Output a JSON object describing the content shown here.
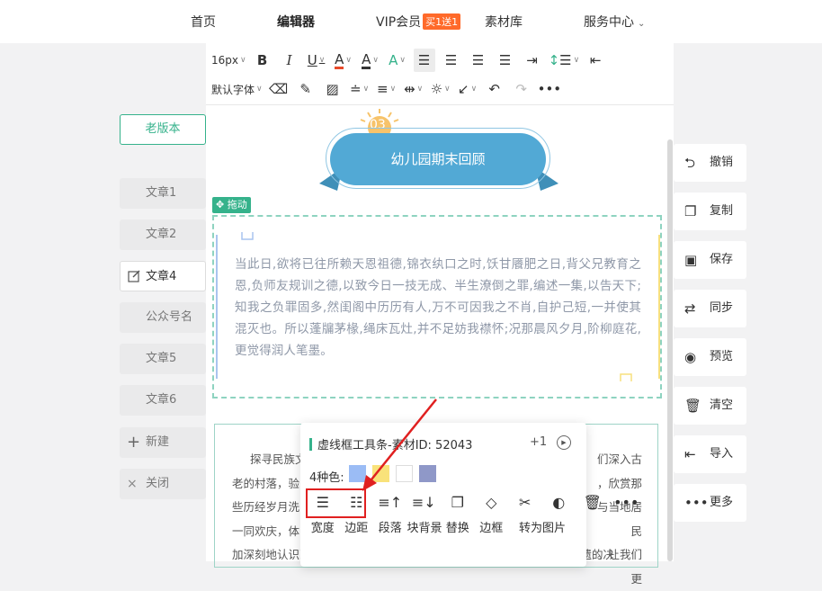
{
  "nav": {
    "home": "首页",
    "editor": "编辑器",
    "vip": "VIP会员",
    "vip_badge": "买1送1",
    "materials": "素材库",
    "service": "服务中心"
  },
  "toolbar": {
    "font_size": "16px",
    "font_family": "默认字体"
  },
  "sidebar": {
    "old_version": "老版本",
    "items": [
      {
        "label": "文章1"
      },
      {
        "label": "文章2"
      },
      {
        "label": "文章4"
      },
      {
        "label": "公众号名"
      },
      {
        "label": "文章5"
      },
      {
        "label": "文章6"
      },
      {
        "label": "新建"
      },
      {
        "label": "关闭"
      }
    ]
  },
  "editor": {
    "banner_number": "03",
    "banner_title": "幼儿园期末回顾",
    "drag_tag": "拖动",
    "frame_text": "当此日,欲将已往所赖天恩祖德,锦衣纨口之时,饫甘餍肥之日,背父兄教育之恩,负师友规训之德,以致今日一技无成、半生潦倒之罪,编述一集,以告天下;知我之负罪固多,然闺阁中历历有人,万不可因我之不肖,自护己短,一并使其混灭也。所以蓬牖茅椽,绳床瓦灶,并不足妨我襟怀;况那晨风夕月,阶柳庭花,更觉得润人笔墨。",
    "article2_lines": [
      "探寻民族文",
      "老的村落，验",
      "些历经岁月洗",
      "一同欢庆，体",
      "加深刻地认识到民族文化的博大精深，也更加坚定了我们传承和保护非遗的决"
    ],
    "article2_right": [
      "们深入古",
      "，欣赏那",
      "与当地居民",
      "。让我们更"
    ]
  },
  "popup": {
    "title": "虚线框工具条-素材ID: 52043",
    "plus": "+1",
    "colors_label": "4种色:",
    "colors": [
      "#9bbcf5",
      "#f9e27a",
      "#ffffff",
      "#8f98c8"
    ],
    "tools": [
      {
        "icon": "width-icon",
        "label": "宽度"
      },
      {
        "icon": "margin-icon",
        "label": "边距"
      },
      {
        "icon": "paragraph-up-icon",
        "label": "段落"
      },
      {
        "icon": "paragraph-down-icon",
        "label": "块背景"
      },
      {
        "icon": "copy-icon",
        "label": "替换"
      },
      {
        "icon": "eraser-icon",
        "label": "边框"
      },
      {
        "icon": "scissors-icon",
        "label": "转为图片"
      },
      {
        "icon": "contrast-icon",
        "label": ""
      },
      {
        "icon": "trash-icon",
        "label": ""
      },
      {
        "icon": "more-icon",
        "label": ""
      }
    ]
  },
  "actions": [
    {
      "icon": "undo-icon",
      "label": "撤销"
    },
    {
      "icon": "copy-icon",
      "label": "复制"
    },
    {
      "icon": "save-icon",
      "label": "保存"
    },
    {
      "icon": "sync-icon",
      "label": "同步"
    },
    {
      "icon": "eye-icon",
      "label": "预览"
    },
    {
      "icon": "trash-icon",
      "label": "清空"
    },
    {
      "icon": "import-icon",
      "label": "导入"
    },
    {
      "icon": "more-icon",
      "label": "更多"
    }
  ],
  "colors": {
    "accent": "#35b28b",
    "banner": "#52a9d5",
    "vip": "#ff6a2a",
    "highlight": "#e02020"
  }
}
